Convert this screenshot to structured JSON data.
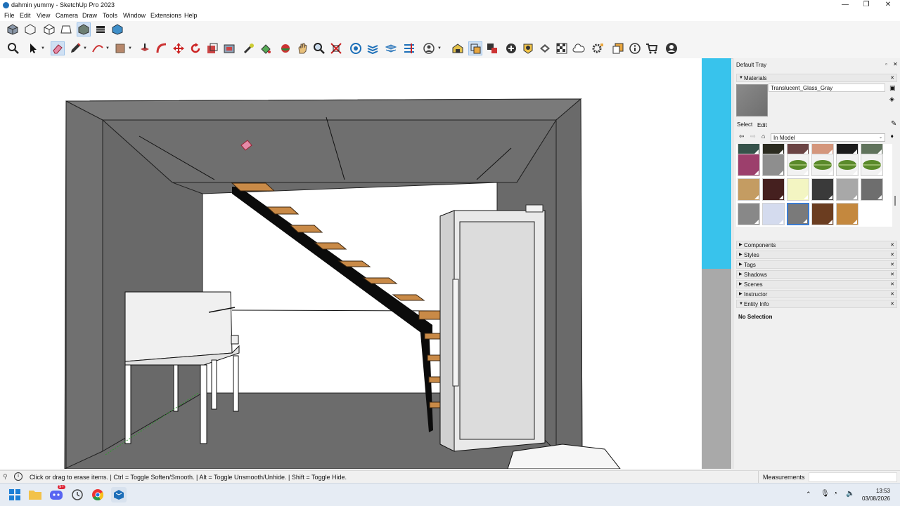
{
  "window": {
    "title": "dahmin yummy - SketchUp Pro 2023",
    "minimize": "—",
    "restore": "❐",
    "close": "✕"
  },
  "menu": [
    "File",
    "Edit",
    "View",
    "Camera",
    "Draw",
    "Tools",
    "Window",
    "Extensions",
    "Help"
  ],
  "toolbar_row1": [
    "iso-view-icon",
    "wireframe-icon",
    "hidden-line-icon",
    "shaded-icon",
    "shaded-texture-icon",
    "monochrome-icon",
    "xray-icon"
  ],
  "toolbar_row2": [
    "zoom-icon",
    "select-icon",
    "eraser-icon",
    "pencil-icon",
    "arc-icon",
    "rectangle-icon",
    "pushpull-icon",
    "move-icon",
    "rotate-icon",
    "scale-icon",
    "offset-icon",
    "follow-me-icon",
    "tape-icon",
    "paint-icon",
    "orbit-icon",
    "pan-icon",
    "zoom-window-icon",
    "zoom-extents-icon",
    "section-icon",
    "tags-icon",
    "layers-icon",
    "outliner-icon",
    "profile-icon",
    "warehouse-icon",
    "extension-icon",
    "solid-icon",
    "add-icon",
    "trimble-icon",
    "styles-icon",
    "checker-icon",
    "cloud-icon",
    "settings-icon",
    "copy-icon",
    "info-icon",
    "cart-icon",
    "account-icon"
  ],
  "tray": {
    "title": "Default Tray",
    "materials_header": "Materials",
    "material_name": "Translucent_Glass_Gray",
    "tab_select": "Select",
    "tab_edit": "Edit",
    "dropdown_value": "In Model",
    "panels": [
      "Components",
      "Styles",
      "Tags",
      "Shadows",
      "Scenes",
      "Instructor",
      "Entity Info"
    ],
    "entity_info_text": "No Selection"
  },
  "swatch_colors": {
    "row0": [
      "#35524a",
      "#2b2b20",
      "#6b4444",
      "#d4967c",
      "#1c1c1c",
      "#60735c"
    ],
    "row1": [
      "#9c3f6c",
      "#8e8e8e",
      "leaf",
      "leaf",
      "leaf",
      "leaf"
    ],
    "row2": [
      "#c49c62",
      "#45201f",
      "#f3f5c2",
      "#3a3a3a",
      "#a8a8a8",
      "#6e6e6e"
    ],
    "row3": [
      "#888888",
      "#d4dbee",
      "#7a7a7a",
      "#6b3d20",
      "#c4883e"
    ]
  },
  "status": {
    "hint": "Click or drag to erase items. | Ctrl = Toggle Soften/Smooth. | Alt = Toggle Unsmooth/Unhide. | Shift = Toggle Hide.",
    "measurements_label": "Measurements"
  },
  "clock": {
    "time": "13:53",
    "date": "03/08/2026"
  },
  "taskbar": {
    "discord_badge": "9+"
  }
}
